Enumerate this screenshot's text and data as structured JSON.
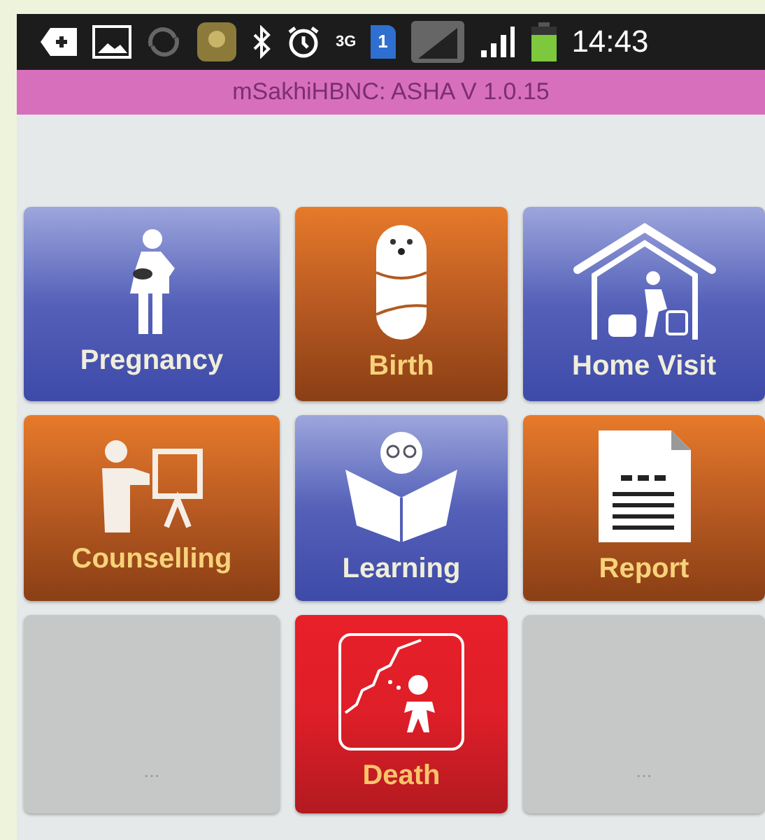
{
  "status_bar": {
    "network": "3G",
    "sim": "1",
    "time": "14:43"
  },
  "title_bar": {
    "title": "mSakhiHBNC: ASHA V 1.0.15"
  },
  "tiles": [
    {
      "kind": "blue",
      "label": "Pregnancy"
    },
    {
      "kind": "orange",
      "label": "Birth"
    },
    {
      "kind": "blue",
      "label": "Home Visit"
    },
    {
      "kind": "orange",
      "label": "Counselling"
    },
    {
      "kind": "blue",
      "label": "Learning"
    },
    {
      "kind": "orange",
      "label": "Report"
    },
    {
      "kind": "gray",
      "label": "..."
    },
    {
      "kind": "red",
      "label": "Death"
    },
    {
      "kind": "gray",
      "label": "..."
    }
  ]
}
